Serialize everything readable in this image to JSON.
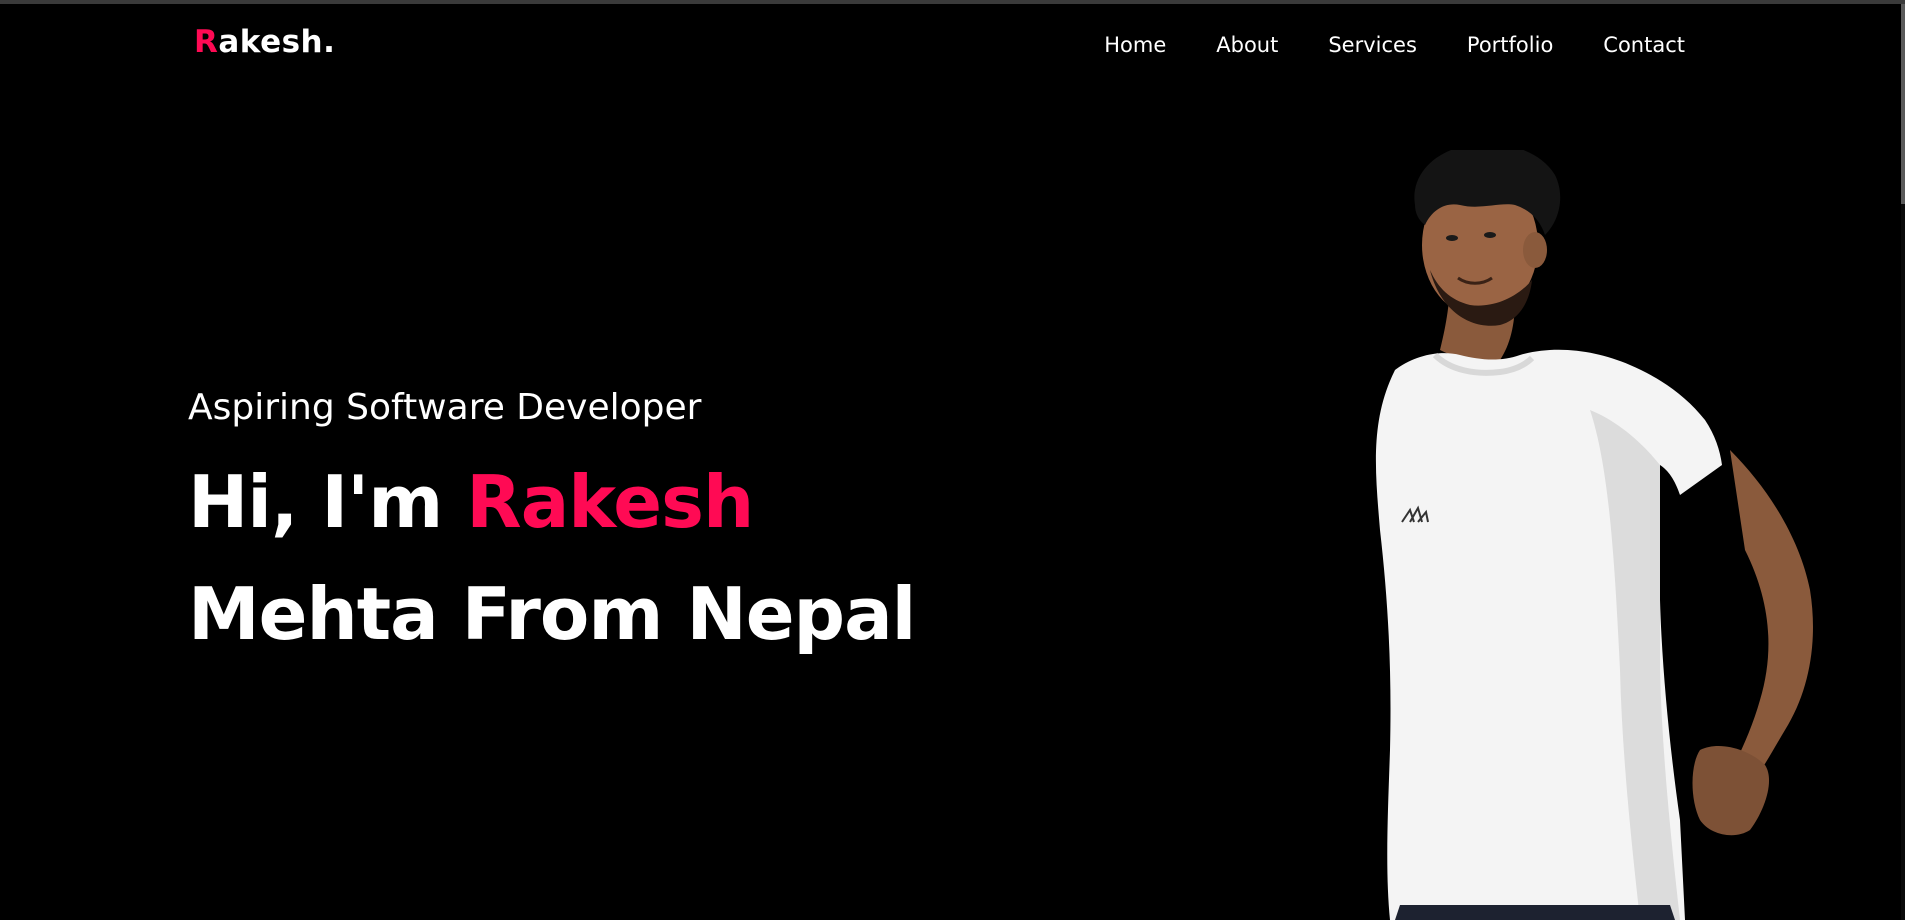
{
  "logo": {
    "initial": "R",
    "rest": "akesh."
  },
  "nav": {
    "items": [
      "Home",
      "About",
      "Services",
      "Portfolio",
      "Contact"
    ]
  },
  "hero": {
    "subtitle": "Aspiring Software Developer",
    "greeting": "Hi, I'm ",
    "name_first": "Rakesh",
    "name_rest": "Mehta From Nepal"
  },
  "colors": {
    "accent": "#ff0a54",
    "background": "#000000",
    "text": "#ffffff"
  }
}
